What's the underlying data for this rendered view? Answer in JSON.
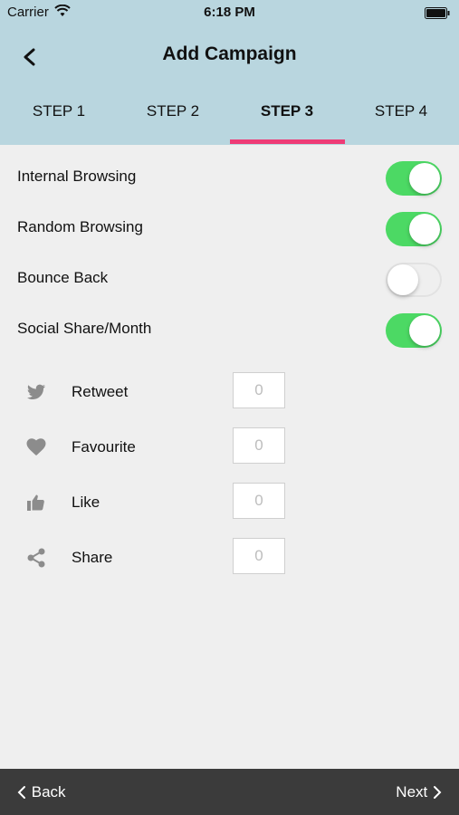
{
  "status_bar": {
    "carrier": "Carrier",
    "time": "6:18 PM"
  },
  "header": {
    "title": "Add Campaign"
  },
  "tabs": [
    {
      "label": "STEP 1"
    },
    {
      "label": "STEP 2"
    },
    {
      "label": "STEP 3",
      "active": true
    },
    {
      "label": "STEP 4"
    }
  ],
  "toggles": [
    {
      "label": "Internal Browsing",
      "on": true
    },
    {
      "label": "Random Browsing",
      "on": true
    },
    {
      "label": "Bounce Back",
      "on": false
    },
    {
      "label": "Social Share/Month",
      "on": true
    }
  ],
  "social": [
    {
      "label": "Retweet",
      "icon": "twitter-icon",
      "value": "0"
    },
    {
      "label": "Favourite",
      "icon": "heart-icon",
      "value": "0"
    },
    {
      "label": "Like",
      "icon": "thumbs-up-icon",
      "value": "0"
    },
    {
      "label": "Share",
      "icon": "share-icon",
      "value": "0"
    }
  ],
  "footer": {
    "back_label": "Back",
    "next_label": "Next"
  },
  "colors": {
    "header_bg": "#b9d6df",
    "accent": "#ee3c76",
    "switch_on": "#4cd964",
    "footer_bg": "#3b3b3b"
  }
}
